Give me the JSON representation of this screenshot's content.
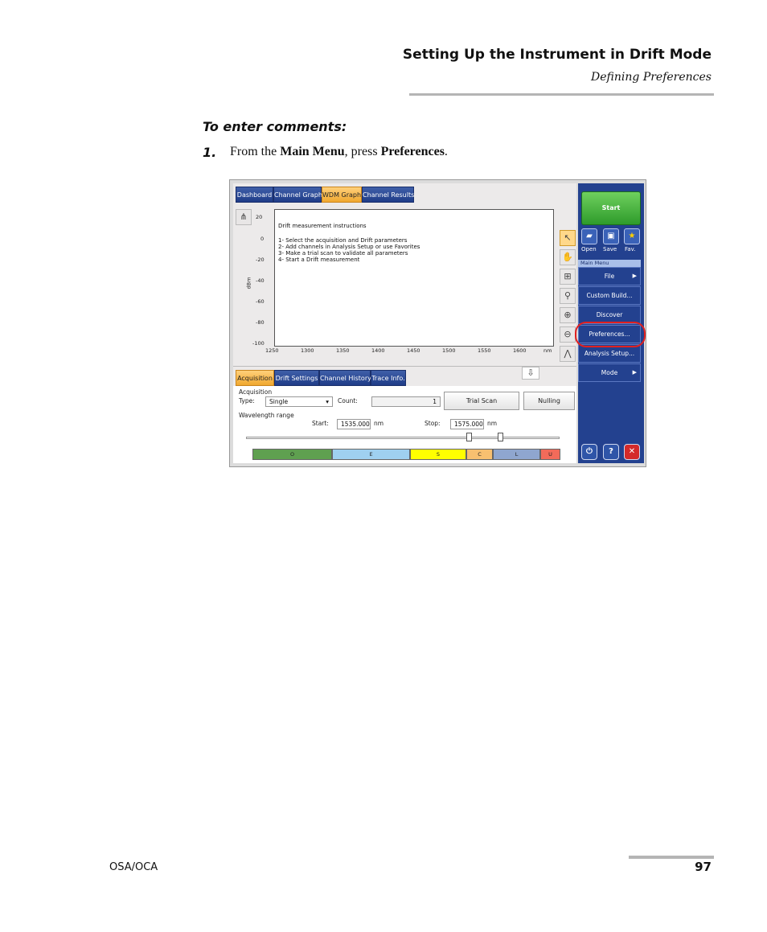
{
  "header": {
    "title": "Setting Up the Instrument in Drift Mode",
    "subtitle": "Defining Preferences"
  },
  "procedure": {
    "title": "To enter comments:",
    "step_number": "1.",
    "step_prefix": "From the ",
    "step_bold1": "Main Menu",
    "step_mid": ", press ",
    "step_bold2": "Preferences",
    "step_suffix": "."
  },
  "app": {
    "tabs": [
      "Dashboard",
      "Channel Graph",
      "WDM Graph",
      "Channel Results"
    ],
    "active_tab": "WDM Graph",
    "plot": {
      "y_label": "dBm",
      "x_unit": "nm",
      "y_ticks": [
        "20",
        "0",
        "-20",
        "-40",
        "-60",
        "-80",
        "-100"
      ],
      "x_ticks": [
        "1250",
        "1300",
        "1350",
        "1400",
        "1450",
        "1500",
        "1550",
        "1600"
      ],
      "instructions": [
        "Drift measurement instructions",
        "1- Select the acquisition and Drift parameters",
        "2- Add channels in Analysis Setup or use Favorites",
        "3- Make a trial scan to validate all parameters",
        "4- Start a Drift measurement"
      ]
    },
    "bottom_tabs": [
      "Acquisition",
      "Drift Settings",
      "Channel History",
      "Trace Info."
    ],
    "active_bottom_tab": "Acquisition",
    "acquisition": {
      "section_label": "Acquisition",
      "type_label": "Type:",
      "type_value": "Single",
      "count_label": "Count:",
      "count_value": "1",
      "trial_scan": "Trial Scan",
      "nulling": "Nulling",
      "wavelength_label": "Wavelength range",
      "start_label": "Start:",
      "start_value": "1535.000",
      "stop_label": "Stop:",
      "stop_value": "1575.000",
      "unit": "nm"
    },
    "bands": [
      {
        "label": "O",
        "color": "#5fa050"
      },
      {
        "label": "E",
        "color": "#9fd0f0"
      },
      {
        "label": "S",
        "color": "#ffff00"
      },
      {
        "label": "C",
        "color": "#f8c070"
      },
      {
        "label": "L",
        "color": "#8fa6cf"
      },
      {
        "label": "U",
        "color": "#f26b5a"
      }
    ],
    "right_panel": {
      "start": "Start",
      "open": "Open",
      "save": "Save",
      "fav": "Fav.",
      "main_menu": "Main Menu",
      "menu_items": [
        "File",
        "Custom Build...",
        "Discover",
        "Preferences...",
        "Analysis Setup...",
        "Mode"
      ],
      "highlighted_item": "Preferences..."
    }
  },
  "footer": {
    "product": "OSA/OCA",
    "page": "97"
  }
}
